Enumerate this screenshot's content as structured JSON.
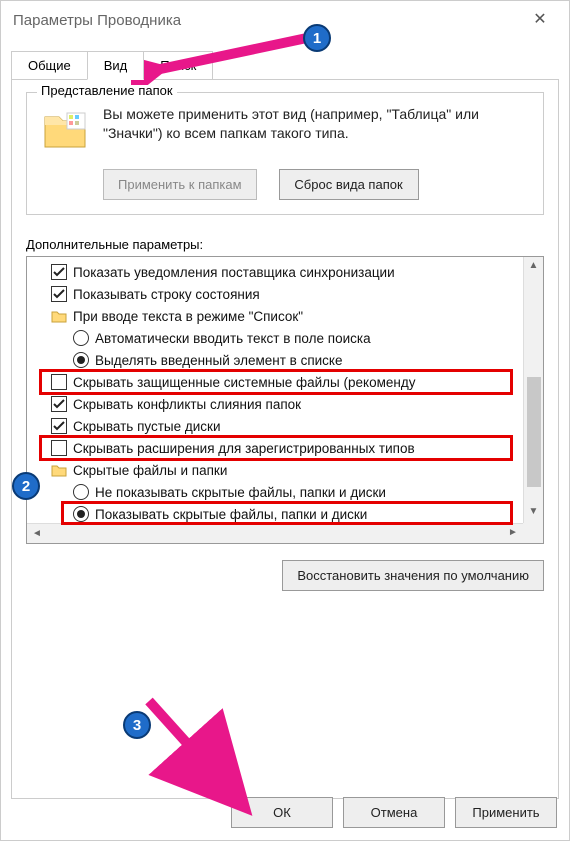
{
  "window": {
    "title": "Параметры Проводника",
    "close_label": "✕"
  },
  "tabs": {
    "general": "Общие",
    "view": "Вид",
    "search": "Поиск"
  },
  "folder_views": {
    "legend": "Представление папок",
    "text": "Вы можете применить этот вид (например, \"Таблица\" или \"Значки\") ко всем папкам такого типа.",
    "apply_btn": "Применить к папкам",
    "reset_btn": "Сброс вида папок"
  },
  "advanced": {
    "label": "Дополнительные параметры:",
    "items": {
      "sync_notif": "Показать уведомления поставщика синхронизации",
      "status_bar": "Показывать строку состояния",
      "list_typing_heading": "При вводе текста в режиме \"Список\"",
      "list_typing_search": "Автоматически вводить текст в поле поиска",
      "list_typing_select": "Выделять введенный элемент в списке",
      "hide_protected": "Скрывать защищенные системные файлы (рекоменду",
      "hide_merge": "Скрывать конфликты слияния папок",
      "hide_empty": "Скрывать пустые диски",
      "hide_ext": "Скрывать расширения для зарегистрированных типов",
      "hidden_heading": "Скрытые файлы и папки",
      "hidden_no": "Не показывать скрытые файлы, папки и диски",
      "hidden_yes": "Показывать скрытые файлы, папки и диски"
    }
  },
  "restore_btn": "Восстановить значения по умолчанию",
  "dialog": {
    "ok": "ОК",
    "cancel": "Отмена",
    "apply": "Применить"
  },
  "badges": {
    "one": "1",
    "two": "2",
    "three": "3"
  }
}
